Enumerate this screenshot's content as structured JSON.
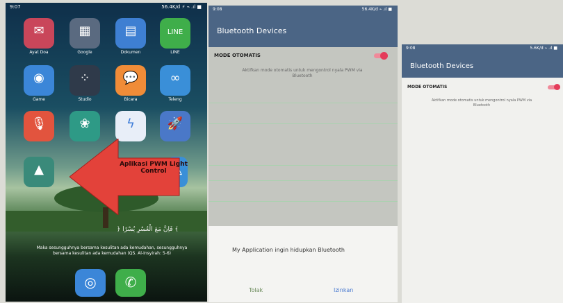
{
  "panel1": {
    "status_time": "9:07",
    "status_right": "56.4K/d ⚡ ⌁ .ıl ■",
    "apps": [
      {
        "label": "Ayat Doa",
        "color": "#c9465a",
        "icon": "book-icon"
      },
      {
        "label": "Google",
        "color": "#5a6a80",
        "icon": "grid-icon"
      },
      {
        "label": "Dokumen",
        "color": "#3e7fd2",
        "icon": "document-icon"
      },
      {
        "label": "LINE",
        "color": "#3fae4a",
        "icon": "chat-icon"
      },
      {
        "label": "Game",
        "color": "#3b86d8",
        "icon": "gamepad-icon"
      },
      {
        "label": "Studio",
        "color": "#2f3a4a",
        "icon": "dots-icon"
      },
      {
        "label": "Bicara",
        "color": "#f08c38",
        "icon": "speech-icon"
      },
      {
        "label": "Teleng",
        "color": "#3a8fd8",
        "icon": "loop-icon"
      },
      {
        "label": "",
        "color": "#e2543e",
        "icon": "podcast-icon"
      },
      {
        "label": "",
        "color": "#2e9a86",
        "icon": "leaf-icon"
      },
      {
        "label": "",
        "color": "#e8eef8",
        "icon": "messenger-icon"
      },
      {
        "label": "",
        "color": "#4a78c8",
        "icon": "rocket-icon"
      },
      {
        "label": "",
        "color": "#3a8a7a",
        "icon": "android-icon"
      },
      {
        "label": "",
        "color": "#3a8fd8",
        "icon": "triangle-icon"
      }
    ],
    "arrow_text": "Aplikasi PWM Light Control",
    "arabic_text": "﴿ فَاِنَّ مَعَ الْعُسْرِ يُسْرًا ﴾",
    "caption": "Maka sesungguhnya bersama kesulitan ada kemudahan, sesungguhnya bersama kesulitan ada kemudahan (QS. Al-Insyirah: 5-6)",
    "dock": [
      {
        "icon": "camera-icon",
        "color": "#3b86d8"
      },
      {
        "icon": "phone-icon",
        "color": "#3fae4a"
      }
    ]
  },
  "panel2": {
    "status_time": "9:08",
    "status_right": "56.4K/d ⌁ .ıl ■",
    "title": "Bluetooth Devices",
    "mode_label": "MODE OTOMATIS",
    "hint": "Aktifkan mode otomatis untuk mengontrol nyala PWM via Bluetooth",
    "dialog_message": "My Application ingin hidupkan Bluetooth",
    "deny_label": "Tolak",
    "allow_label": "Izinkan"
  },
  "panel3": {
    "status_time": "9:08",
    "status_right": "5.6K/d ⌁ .ıl ■",
    "title": "Bluetooth Devices",
    "mode_label": "MODE OTOMATIS",
    "hint": "Aktifkan mode otomatis untuk mengontrol nyala PWM via Bluetooth"
  }
}
